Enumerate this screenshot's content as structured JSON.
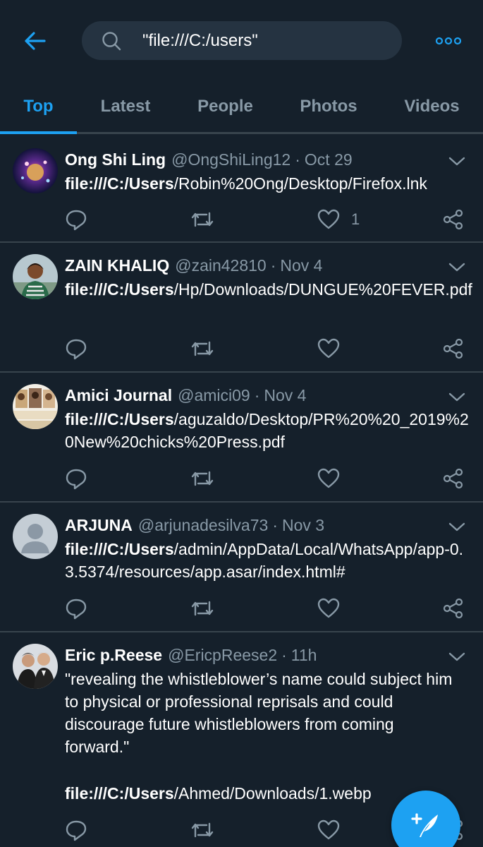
{
  "search": {
    "query": "\"file:///C:/users\""
  },
  "tabs": [
    {
      "label": "Top"
    },
    {
      "label": "Latest"
    },
    {
      "label": "People"
    },
    {
      "label": "Photos"
    },
    {
      "label": "Videos"
    }
  ],
  "tweets": [
    {
      "name": "Ong Shi Ling",
      "handle": "@OngShiLing12",
      "time": "Oct 29",
      "bold": "file:///C:/Users",
      "text": "/Robin%20Ong/Desktop/Firefox.lnk",
      "likes": "1"
    },
    {
      "name": "ZAIN KHALIQ",
      "handle": "@zain42810",
      "time": "Nov 4",
      "bold": "file:///C:/Users",
      "text": "/Hp/Downloads/DUNGUE%20FEVER.pdf",
      "likes": ""
    },
    {
      "name": "Amici Journal",
      "handle": "@amici09",
      "time": "Nov 4",
      "bold": "file:///C:/Users",
      "text": "/aguzaldo/Desktop/PR%20%20_2019%20New%20chicks%20Press.pdf",
      "likes": ""
    },
    {
      "name": "ARJUNA",
      "handle": "@arjunadesilva73",
      "time": "Nov 3",
      "bold": "file:///C:/Users",
      "text": "/admin/AppData/Local/WhatsApp/app-0.3.5374/resources/app.asar/index.html#",
      "likes": ""
    },
    {
      "name": "Eric p.Reese",
      "handle": "@EricpReese2",
      "time": "11h",
      "quote": "\"revealing the whistleblower’s name could subject him to physical or professional reprisals and could discourage future whistleblowers from coming forward.\"",
      "bold": "file:///C:/Users",
      "text": "/Ahmed/Downloads/1.webp",
      "likes": ""
    }
  ],
  "colors": {
    "background": "#15202b",
    "accent": "#1da1f2",
    "muted": "#8899a6",
    "divider": "#38444d",
    "search_bg": "#253341"
  },
  "icons": {
    "back": "arrow-left-icon",
    "search": "search-icon",
    "more": "more-horizontal-icon",
    "reply": "reply-icon",
    "retweet": "retweet-icon",
    "like": "heart-icon",
    "share": "share-icon",
    "compose": "compose-icon"
  }
}
